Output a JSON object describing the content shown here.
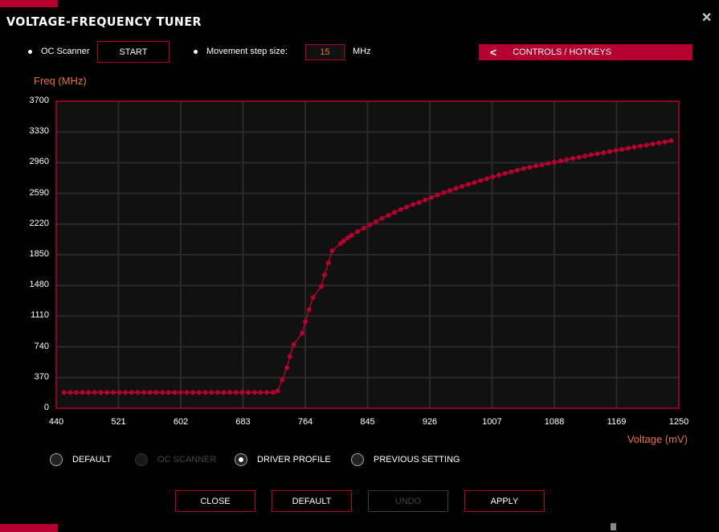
{
  "window": {
    "title": "VOLTAGE-FREQUENCY TUNER",
    "close_icon": "close-icon"
  },
  "toolbar": {
    "oc_scanner_label": "OC Scanner",
    "start_label": "START",
    "step_label": "Movement step size:",
    "step_value": "15",
    "step_unit": "MHz",
    "controls_label": "CONTROLS / HOTKEYS"
  },
  "colors": {
    "accent": "#b5002f",
    "axis_label": "#e8733a",
    "plot_bg": "#111111",
    "grid": "#2a2a2a"
  },
  "chart_data": {
    "type": "line",
    "xlabel": "Voltage (mV)",
    "ylabel": "Freq (MHz)",
    "xlim": [
      440,
      1250
    ],
    "ylim": [
      0,
      3700
    ],
    "xticks": [
      "440",
      "521",
      "602",
      "683",
      "764",
      "845",
      "926",
      "1007",
      "1088",
      "1169",
      "1250"
    ],
    "yticks": [
      "0",
      "370",
      "740",
      "1110",
      "1480",
      "1850",
      "2220",
      "2590",
      "2960",
      "3330",
      "3700"
    ],
    "grid": true,
    "x": [
      450,
      458,
      466,
      474,
      482,
      490,
      498,
      506,
      514,
      522,
      530,
      538,
      546,
      554,
      562,
      570,
      578,
      586,
      594,
      602,
      610,
      618,
      626,
      634,
      642,
      650,
      658,
      666,
      674,
      682,
      690,
      698,
      706,
      714,
      722,
      728,
      734,
      740,
      744,
      749,
      760,
      764,
      769,
      774,
      785,
      789,
      794,
      799,
      810,
      814,
      819,
      824,
      832,
      840,
      848,
      856,
      864,
      872,
      880,
      888,
      896,
      904,
      912,
      920,
      928,
      936,
      944,
      952,
      960,
      968,
      976,
      984,
      992,
      1000,
      1008,
      1016,
      1024,
      1032,
      1040,
      1048,
      1056,
      1064,
      1072,
      1080,
      1088,
      1096,
      1104,
      1112,
      1120,
      1128,
      1136,
      1144,
      1152,
      1160,
      1168,
      1176,
      1184,
      1192,
      1200,
      1208,
      1216,
      1224,
      1232,
      1240
    ],
    "y": [
      190,
      190,
      190,
      190,
      190,
      190,
      190,
      190,
      190,
      190,
      190,
      190,
      190,
      190,
      190,
      190,
      190,
      190,
      190,
      190,
      190,
      190,
      190,
      190,
      190,
      190,
      190,
      190,
      190,
      190,
      190,
      190,
      190,
      190,
      190,
      210,
      341,
      487,
      623,
      769,
      906,
      1042,
      1188,
      1334,
      1470,
      1607,
      1753,
      1899,
      1986,
      2016,
      2054,
      2084,
      2130,
      2170,
      2210,
      2250,
      2290,
      2325,
      2360,
      2395,
      2425,
      2455,
      2480,
      2510,
      2540,
      2570,
      2600,
      2625,
      2650,
      2675,
      2700,
      2720,
      2745,
      2765,
      2790,
      2810,
      2830,
      2850,
      2870,
      2890,
      2905,
      2920,
      2935,
      2950,
      2965,
      2980,
      2995,
      3010,
      3025,
      3040,
      3055,
      3068,
      3080,
      3095,
      3108,
      3120,
      3135,
      3148,
      3160,
      3172,
      3185,
      3198,
      3210,
      3225
    ]
  },
  "profiles": [
    {
      "label": "DEFAULT",
      "selected": false,
      "disabled": false
    },
    {
      "label": "OC SCANNER",
      "selected": false,
      "disabled": true
    },
    {
      "label": "DRIVER PROFILE",
      "selected": true,
      "disabled": false
    },
    {
      "label": "PREVIOUS SETTING",
      "selected": false,
      "disabled": false
    }
  ],
  "footer": {
    "close": "CLOSE",
    "default": "DEFAULT",
    "undo": "UNDO",
    "apply": "APPLY"
  }
}
